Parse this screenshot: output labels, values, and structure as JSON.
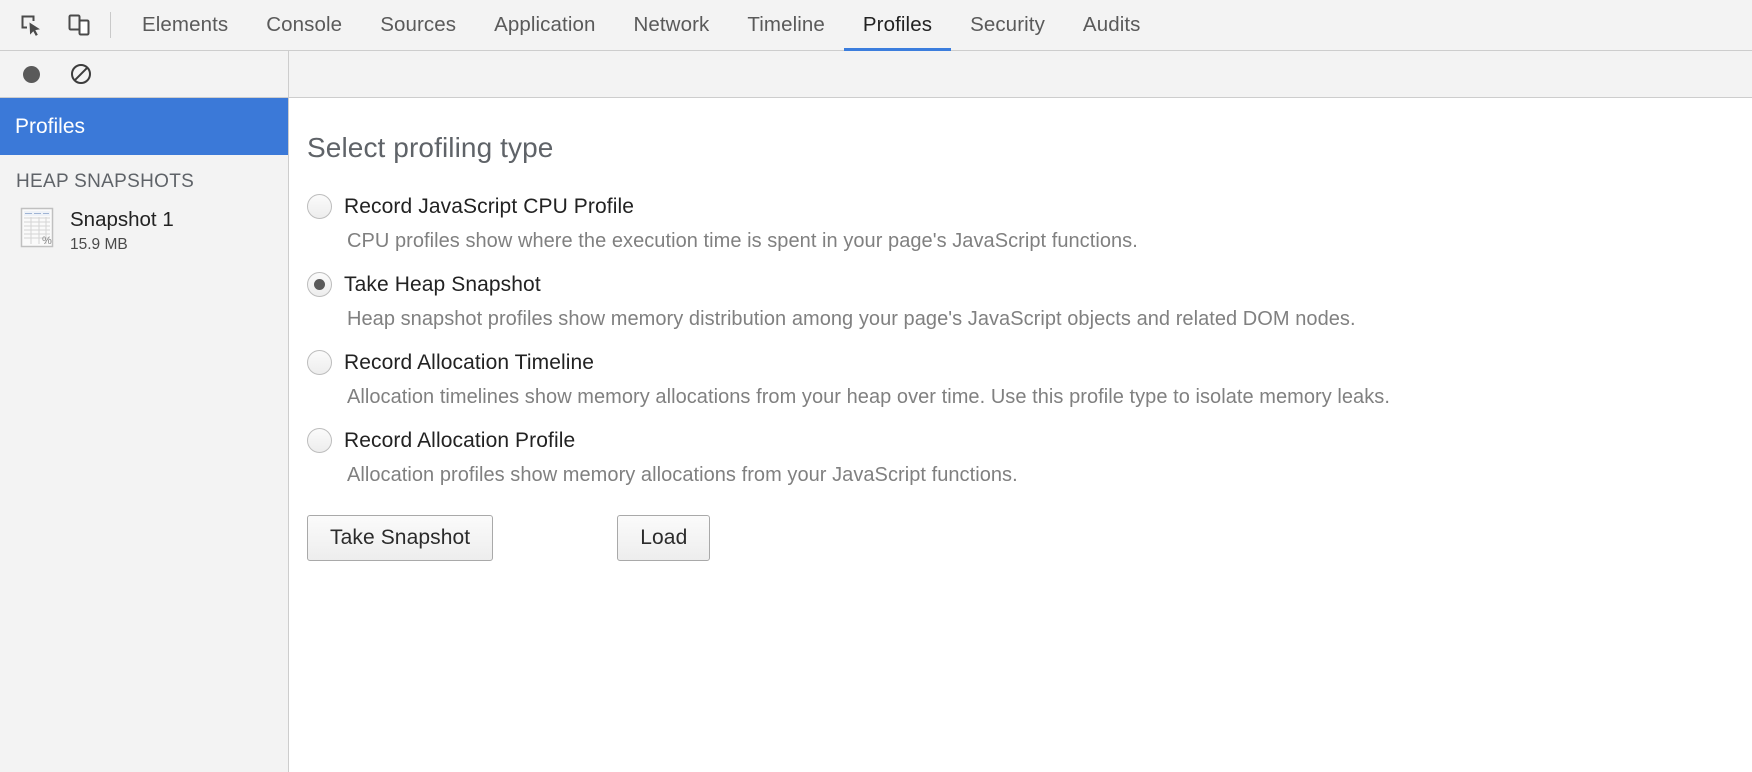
{
  "toolbar": {
    "inspect_icon_title": "inspect-element-icon",
    "device_icon_title": "toggle-device-toolbar-icon",
    "tabs": [
      {
        "label": "Elements",
        "active": false
      },
      {
        "label": "Console",
        "active": false
      },
      {
        "label": "Sources",
        "active": false
      },
      {
        "label": "Application",
        "active": false
      },
      {
        "label": "Network",
        "active": false
      },
      {
        "label": "Timeline",
        "active": false
      },
      {
        "label": "Profiles",
        "active": true
      },
      {
        "label": "Security",
        "active": false
      },
      {
        "label": "Audits",
        "active": false
      }
    ],
    "active_tab": "Profiles",
    "accent_color": "#3b7ddd"
  },
  "subtoolbar": {
    "record_button_name": "record-button",
    "clear_button_name": "clear-all-profiles-button"
  },
  "sidebar": {
    "header_label": "Profiles",
    "header_bg": "#3b79d8",
    "section_title": "HEAP SNAPSHOTS",
    "snapshots": [
      {
        "name": "Snapshot 1",
        "size": "15.9 MB",
        "icon": "heap-snapshot-icon"
      }
    ]
  },
  "main": {
    "title": "Select profiling type",
    "options": [
      {
        "id": "cpu-profile",
        "label": "Record JavaScript CPU Profile",
        "description": "CPU profiles show where the execution time is spent in your page's JavaScript functions.",
        "checked": false
      },
      {
        "id": "heap-snapshot",
        "label": "Take Heap Snapshot",
        "description": "Heap snapshot profiles show memory distribution among your page's JavaScript objects and related DOM nodes.",
        "checked": true
      },
      {
        "id": "allocation-timeline",
        "label": "Record Allocation Timeline",
        "description": "Allocation timelines show memory allocations from your heap over time. Use this profile type to isolate memory leaks.",
        "checked": false
      },
      {
        "id": "allocation-profile",
        "label": "Record Allocation Profile",
        "description": "Allocation profiles show memory allocations from your JavaScript functions.",
        "checked": false
      }
    ],
    "buttons": {
      "primary": "Take Snapshot",
      "secondary": "Load"
    }
  }
}
